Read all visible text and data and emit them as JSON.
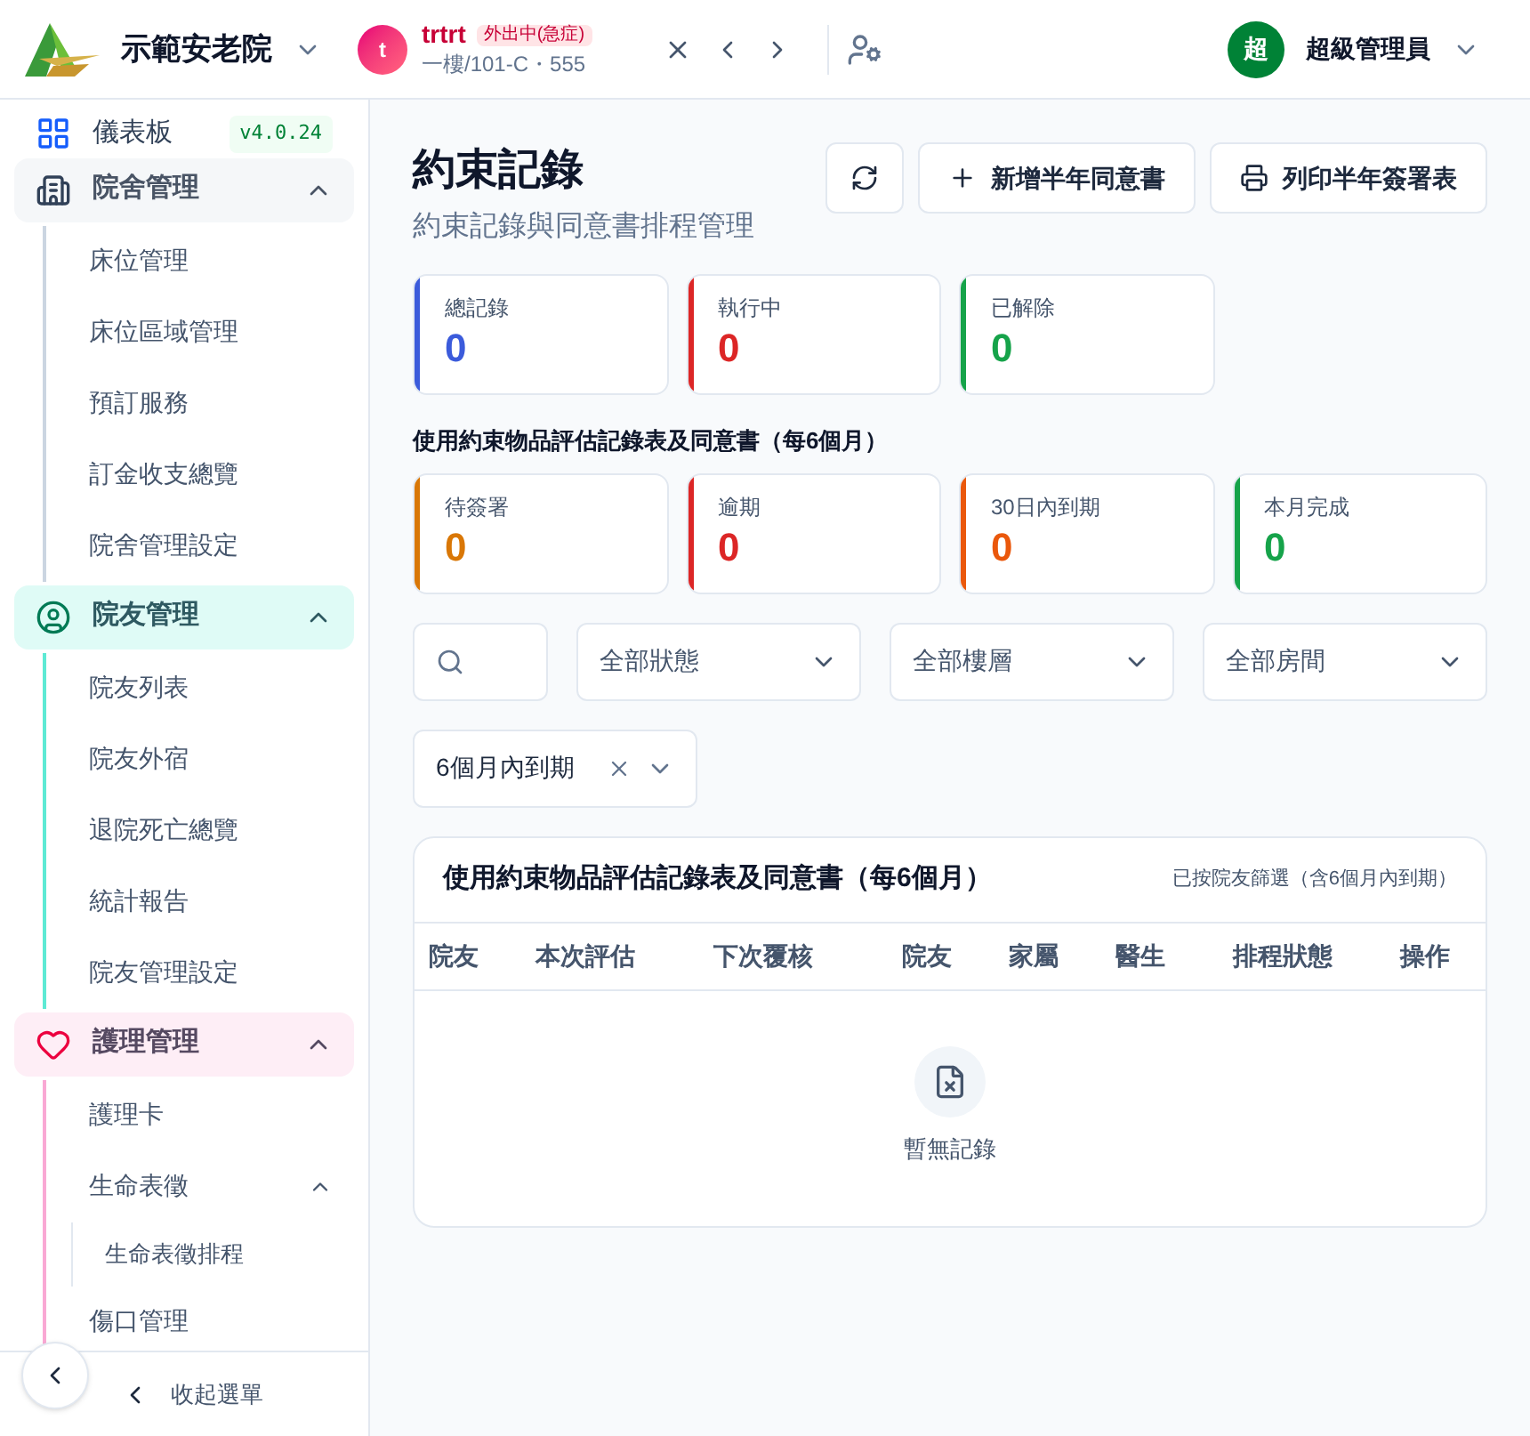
{
  "header": {
    "facility": "示範安老院",
    "resident": {
      "avatar": "t",
      "name": "trtrt",
      "badge": "外出中(急症)",
      "location": "一樓/101-C・555"
    },
    "user": {
      "avatar": "超",
      "name": "超級管理員"
    }
  },
  "sidebar": {
    "items": [
      {
        "kind": "link",
        "label": "儀表板",
        "badge": "v4.0.24"
      },
      {
        "kind": "group",
        "label": "院舍管理",
        "color": "#cbd5e1",
        "expanded": true,
        "children": [
          {
            "kind": "link",
            "label": "床位管理"
          },
          {
            "kind": "link",
            "label": "床位區域管理"
          },
          {
            "kind": "link",
            "label": "預訂服務"
          },
          {
            "kind": "link",
            "label": "訂金收支總覽"
          },
          {
            "kind": "link",
            "label": "院舍管理設定"
          }
        ]
      },
      {
        "kind": "group",
        "label": "院友管理",
        "color": "#5eead4",
        "expanded": true,
        "children": [
          {
            "kind": "link",
            "label": "院友列表"
          },
          {
            "kind": "link",
            "label": "院友外宿"
          },
          {
            "kind": "link",
            "label": "退院死亡總覽"
          },
          {
            "kind": "link",
            "label": "統計報告"
          },
          {
            "kind": "link",
            "label": "院友管理設定"
          }
        ]
      },
      {
        "kind": "group",
        "label": "護理管理",
        "color": "#f9a8d4",
        "expanded": true,
        "children": [
          {
            "kind": "link",
            "label": "護理卡"
          },
          {
            "kind": "group",
            "label": "生命表徵",
            "expanded": true,
            "children": [
              {
                "kind": "link",
                "label": "生命表徵排程"
              }
            ]
          },
          {
            "kind": "link",
            "label": "傷口管理"
          }
        ]
      }
    ],
    "collapse_label": "收起選單"
  },
  "page": {
    "title": "約束記錄",
    "subtitle": "約束記錄與同意書排程管理",
    "actions": [
      {
        "kind": "refresh"
      },
      {
        "kind": "add",
        "label": "新增半年同意書"
      },
      {
        "kind": "print",
        "label": "列印半年簽署表"
      }
    ]
  },
  "stats": [
    {
      "label": "總記錄",
      "value": "0",
      "color": "#3b5bdb"
    },
    {
      "label": "執行中",
      "value": "0",
      "color": "#dc2626"
    },
    {
      "label": "已解除",
      "value": "0",
      "color": "#16a34a"
    }
  ],
  "consent_section": {
    "title": "使用約束物品評估記錄表及同意書（每6個月）",
    "stats": [
      {
        "label": "待簽署",
        "value": "0",
        "color": "#d97706"
      },
      {
        "label": "逾期",
        "value": "0",
        "color": "#dc2626"
      },
      {
        "label": "30日內到期",
        "value": "0",
        "color": "#ea580c"
      },
      {
        "label": "本月完成",
        "value": "0",
        "color": "#16a34a"
      }
    ]
  },
  "filters": {
    "selects": [
      {
        "value": "全部狀態"
      },
      {
        "value": "全部樓層"
      },
      {
        "value": "全部房間"
      }
    ],
    "period": {
      "value": "6個月內到期"
    }
  },
  "table": {
    "title": "使用約束物品評估記錄表及同意書（每6個月）",
    "note": "已按院友篩選（含6個月內到期）",
    "columns": [
      "院友",
      "本次評估",
      "下次覆核",
      "院友",
      "家屬",
      "醫生",
      "排程狀態",
      "操作"
    ],
    "empty": "暫無記錄"
  }
}
